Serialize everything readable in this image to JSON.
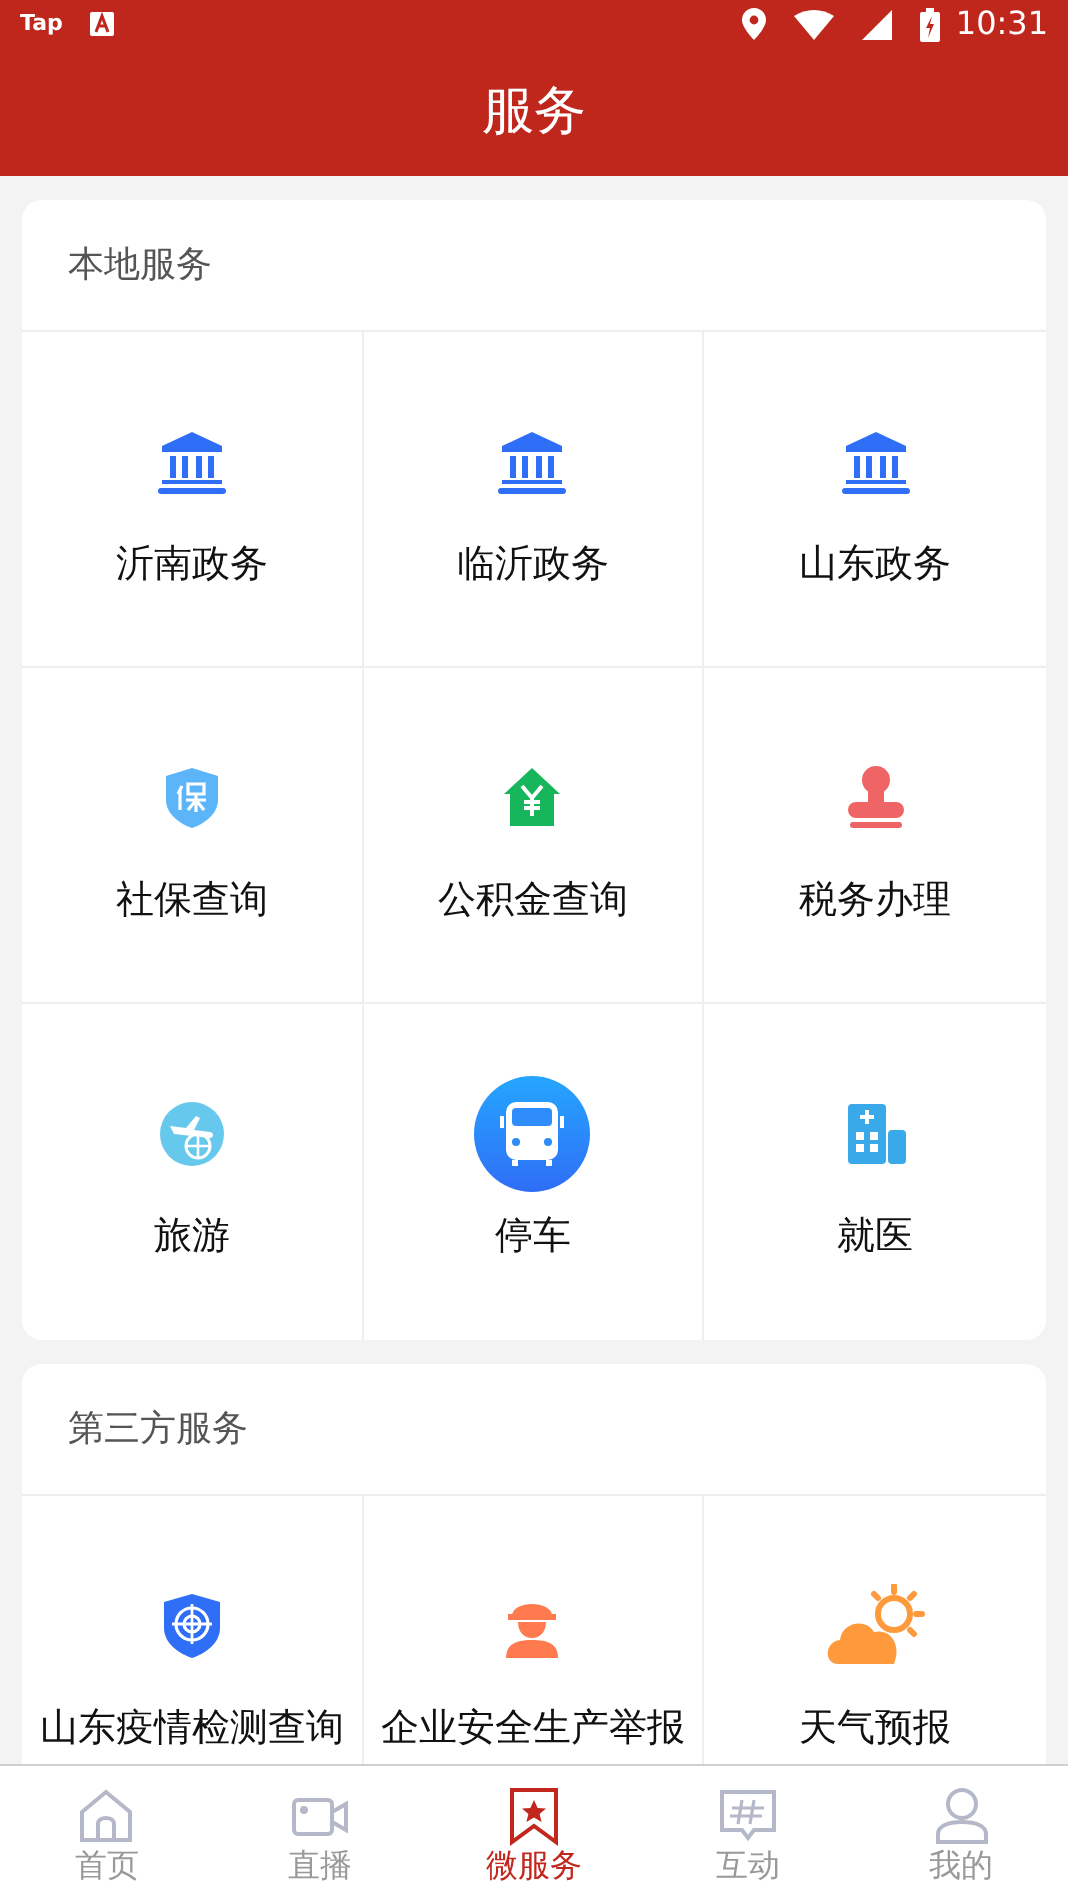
{
  "status_bar": {
    "time": "10:31",
    "app_label": "Tap"
  },
  "header": {
    "title": "服务"
  },
  "sections": [
    {
      "title": "本地服务",
      "items": [
        {
          "label": "沂南政务",
          "kind": "government"
        },
        {
          "label": "临沂政务",
          "kind": "government"
        },
        {
          "label": "山东政务",
          "kind": "government"
        },
        {
          "label": "社保查询",
          "kind": "insurance"
        },
        {
          "label": "公积金查询",
          "kind": "housing"
        },
        {
          "label": "税务办理",
          "kind": "stamp"
        },
        {
          "label": "旅游",
          "kind": "travel"
        },
        {
          "label": "停车",
          "kind": "bus"
        },
        {
          "label": "就医",
          "kind": "hospital"
        }
      ]
    },
    {
      "title": "第三方服务",
      "items": [
        {
          "label": "山东疫情检测查询",
          "kind": "shield"
        },
        {
          "label": "企业安全生产举报",
          "kind": "worker"
        },
        {
          "label": "天气预报",
          "kind": "weather"
        }
      ]
    }
  ],
  "tabs": [
    {
      "label": "首页",
      "kind": "home",
      "selected": false
    },
    {
      "label": "直播",
      "kind": "video",
      "selected": false
    },
    {
      "label": "微服务",
      "kind": "bookmark",
      "selected": true
    },
    {
      "label": "互动",
      "kind": "hash",
      "selected": false
    },
    {
      "label": "我的",
      "kind": "user",
      "selected": false
    }
  ]
}
